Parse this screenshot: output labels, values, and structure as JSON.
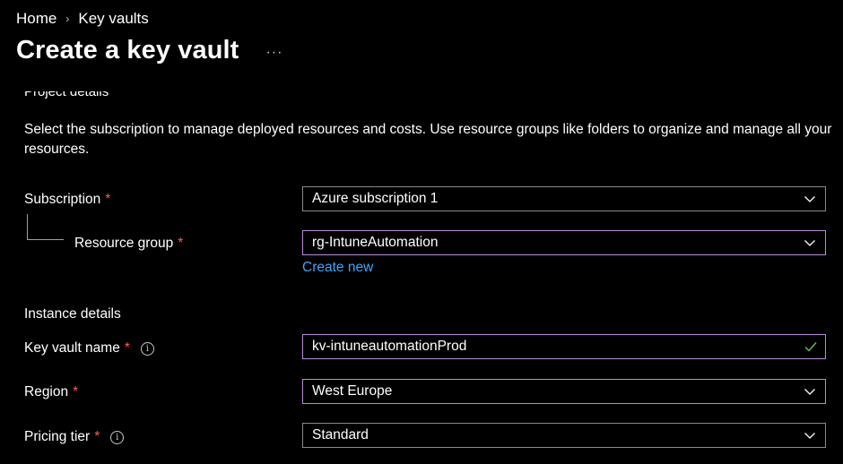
{
  "breadcrumb": {
    "items": [
      "Home",
      "Key vaults"
    ]
  },
  "header": {
    "title": "Create a key vault",
    "more_label": "···"
  },
  "project": {
    "heading_partial": "Project details",
    "description": "Select the subscription to manage deployed resources and costs. Use resource groups like folders to organize and manage all your resources."
  },
  "fields": {
    "subscription": {
      "label": "Subscription",
      "required": "*",
      "value": "Azure subscription 1"
    },
    "resource_group": {
      "label": "Resource group",
      "required": "*",
      "value": "rg-IntuneAutomation",
      "create_new": "Create new"
    },
    "instance_heading": "Instance details",
    "key_vault_name": {
      "label": "Key vault name",
      "required": "*",
      "value": "kv-intuneautomationProd"
    },
    "region": {
      "label": "Region",
      "required": "*",
      "value": "West Europe"
    },
    "pricing_tier": {
      "label": "Pricing tier",
      "required": "*",
      "value": "Standard"
    }
  },
  "icons": {
    "info": "i",
    "chevron": "chevron-down-icon",
    "check": "check-icon"
  },
  "colors": {
    "required": "#ff5a5a",
    "link": "#3ea4ff",
    "focus_border": "#b98ae0",
    "valid_check": "#6fbf4a"
  }
}
